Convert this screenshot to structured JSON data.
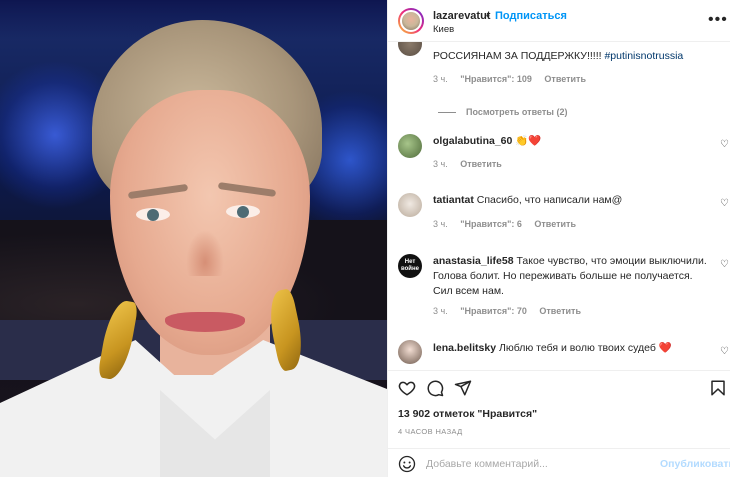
{
  "post": {
    "username": "lazarevatut",
    "follow_label": "Подписаться",
    "separator": "•",
    "location": "Киев",
    "more_icon": "more-horizontal-icon"
  },
  "comments": [
    {
      "username": "",
      "text": "РОССИЯНАМ ЗА ПОДДЕРЖКУ!!!!! ",
      "hashtag": "#putinisnotrussia",
      "time": "3 ч.",
      "likes": "\"Нравится\": 109",
      "reply": "Ответить",
      "view_replies": "Посмотреть ответы (2)"
    },
    {
      "username": "olgalabutina_60",
      "text": "👏❤️",
      "time": "3 ч.",
      "reply": "Ответить"
    },
    {
      "username": "tatiantat",
      "text": "Спасибо, что написали нам@",
      "time": "3 ч.",
      "likes": "\"Нравится\": 6",
      "reply": "Ответить"
    },
    {
      "username": "anastasia_life58",
      "text": "Такое чувство, что эмоции выключили. Голова болит. Но переживать больше не получается. Сил всем нам.",
      "avatar_text_1": "Нет",
      "avatar_text_2": "войне",
      "time": "3 ч.",
      "likes": "\"Нравится\": 70",
      "reply": "Ответить"
    },
    {
      "username": "lena.belitsky",
      "text": "Люблю тебя и волю твоих судеб ❤️"
    }
  ],
  "likes_count": "13 902 отметок \"Нравится\"",
  "posted_time": "4 ЧАСОВ НАЗАД",
  "comment_input": {
    "placeholder": "Добавьте комментарий...",
    "publish_label": "Опубликовать"
  },
  "colors": {
    "accent": "#0095f6",
    "publish_disabled": "#b3dbff",
    "muted": "#8e8e8e",
    "heart": "#ed4956"
  }
}
